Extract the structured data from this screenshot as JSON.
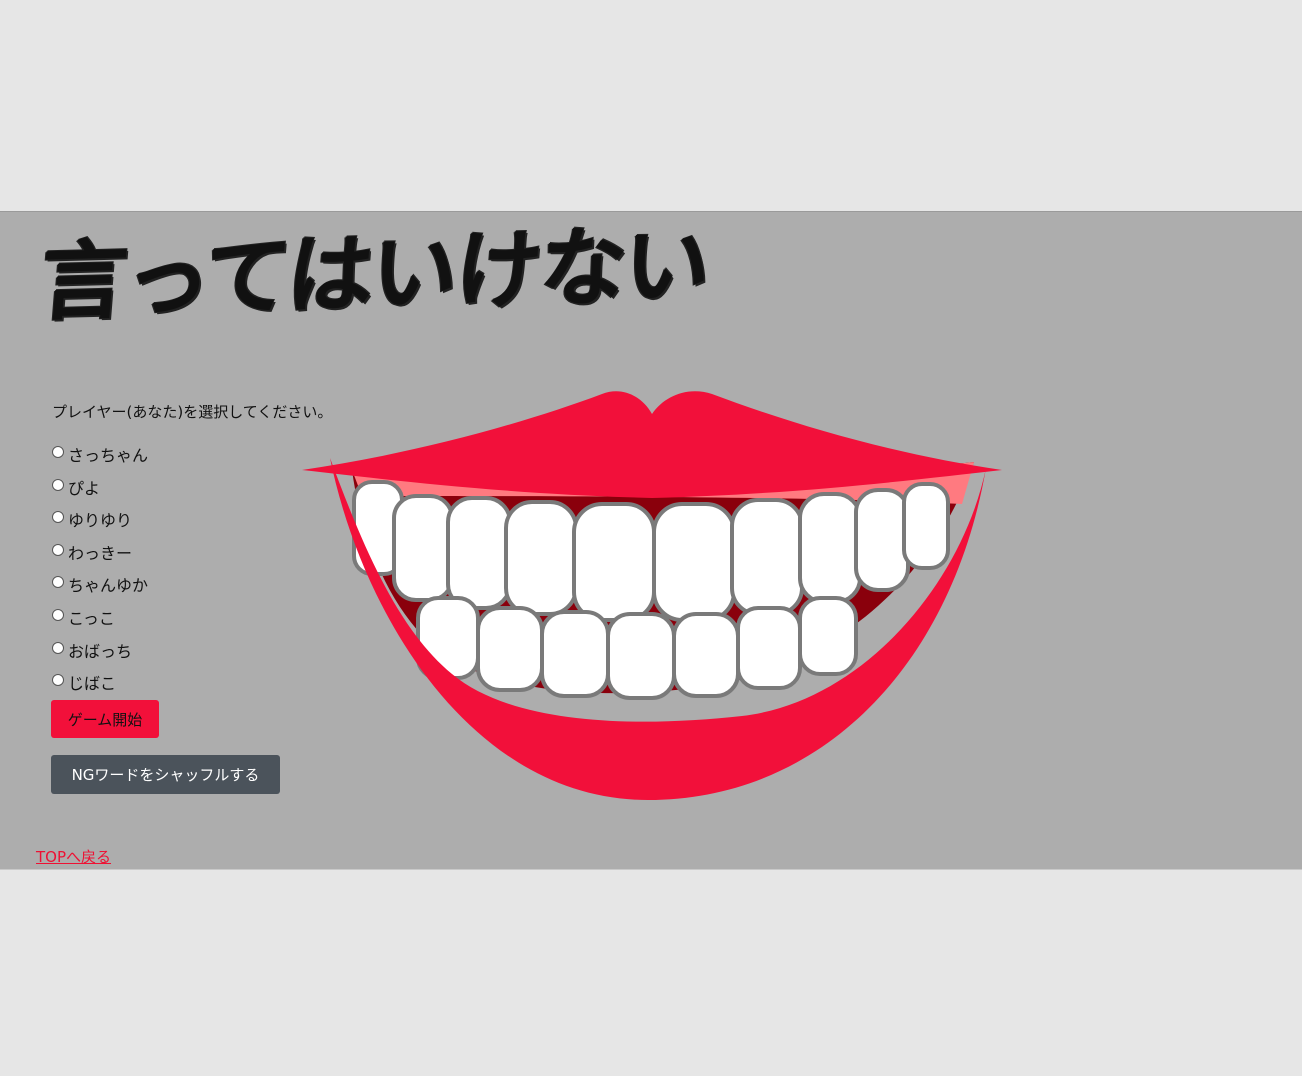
{
  "page": {
    "title": "言ってはいけない",
    "prompt": "プレイヤー(あなた)を選択してください。"
  },
  "players": [
    {
      "label": "さっちゃん"
    },
    {
      "label": "ぴよ"
    },
    {
      "label": "ゆりゆり"
    },
    {
      "label": "わっきー"
    },
    {
      "label": "ちゃんゆか"
    },
    {
      "label": "こっこ"
    },
    {
      "label": "おばっち"
    },
    {
      "label": "じばこ"
    }
  ],
  "buttons": {
    "start": "ゲーム開始",
    "shuffle": "NGワードをシャッフルする"
  },
  "links": {
    "top": "TOPへ戻る"
  },
  "colors": {
    "page_bg": "#e6e6e6",
    "band_bg": "#adadad",
    "lips": "#f2103a",
    "gums": "#ff7a80",
    "start_button": "#f2103a",
    "shuffle_button": "#4b535b",
    "link": "#ee1133"
  },
  "icons": {
    "hero": "smiling-mouth-icon",
    "radio": "radio-icon"
  }
}
